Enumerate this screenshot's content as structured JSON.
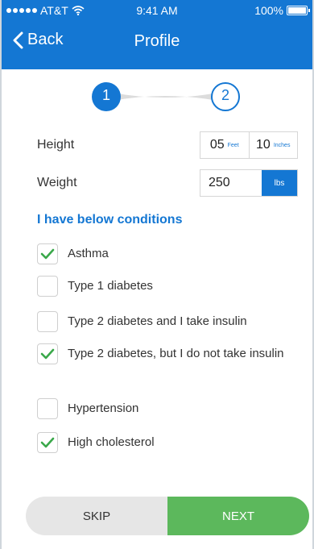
{
  "status_bar": {
    "carrier": "AT&T",
    "time": "9:41 AM",
    "battery": "100%"
  },
  "nav": {
    "back_label": "Back",
    "title": "Profile"
  },
  "stepper": {
    "step1": "1",
    "step2": "2",
    "active_step": 1
  },
  "height": {
    "label": "Height",
    "feet_value": "05",
    "feet_unit": "Feet",
    "inches_value": "10",
    "inches_unit": "Inches"
  },
  "weight": {
    "label": "Weight",
    "value": "250",
    "unit": "lbs"
  },
  "conditions": {
    "title": "I have below conditions",
    "items": [
      {
        "label": "Asthma",
        "checked": true
      },
      {
        "label": "Type 1 diabetes",
        "checked": false
      },
      {
        "label": "Type 2 diabetes and I take insulin",
        "checked": false
      },
      {
        "label": "Type 2 diabetes, but I do not take insulin",
        "checked": true
      },
      {
        "label": "Hypertension",
        "checked": false
      },
      {
        "label": "High cholesterol",
        "checked": true
      }
    ]
  },
  "actions": {
    "skip_label": "SKIP",
    "next_label": "NEXT"
  },
  "colors": {
    "primary": "#1477d3",
    "success": "#5cb85c",
    "check": "#3aa84a"
  }
}
